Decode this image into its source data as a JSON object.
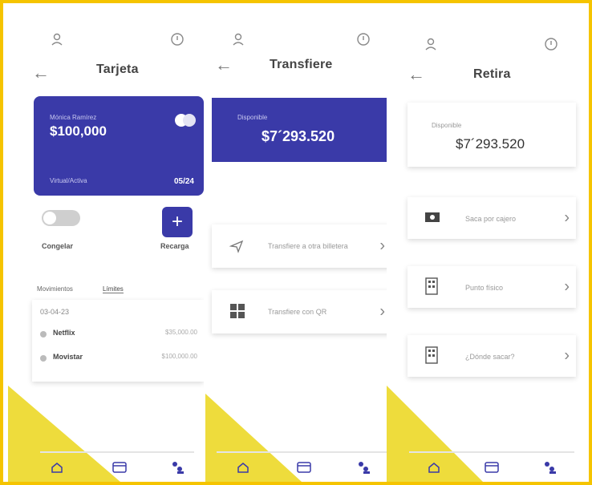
{
  "colors": {
    "accent": "#3a3aa8",
    "frame": "#f5c400",
    "triangle": "#eedc3c"
  },
  "screens": {
    "card": {
      "title": "Tarjeta",
      "card_holder": "Mónica Ramírez",
      "card_amount": "$100,000",
      "card_type": "Virtual/Activa",
      "card_expiry": "05/24",
      "freeze_label": "Congelar",
      "recharge_label": "Recarga",
      "tabs": [
        "Movimientos",
        "Límites"
      ],
      "date": "03-04-23",
      "movements": [
        {
          "name": "Netflix",
          "amount": "$35,000.00"
        },
        {
          "name": "Movistar",
          "amount": "$100,000.00"
        }
      ]
    },
    "transfer": {
      "title": "Transfiere",
      "available_label": "Disponible",
      "balance": "$7´293.520",
      "options": [
        {
          "label": "Transfiere a otra billetera",
          "icon": "send-icon"
        },
        {
          "label": "Transfiere con QR",
          "icon": "qr-icon"
        }
      ]
    },
    "withdraw": {
      "title": "Retira",
      "available_label": "Disponible",
      "balance": "$7´293.520",
      "options": [
        {
          "label": "Saca por cajero",
          "icon": "cash-icon"
        },
        {
          "label": "Punto físico",
          "icon": "building-icon"
        },
        {
          "label": "¿Dónde sacar?",
          "icon": "building-icon"
        }
      ]
    }
  }
}
